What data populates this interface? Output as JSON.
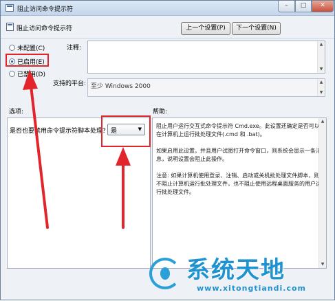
{
  "window": {
    "title": "阻止访问命令提示符",
    "minimize": "–",
    "maximize": "□",
    "close": "✕"
  },
  "header": {
    "title": "阻止访问命令提示符",
    "prev_button": "上一个设置(P)",
    "next_button": "下一个设置(N)"
  },
  "state": {
    "options": [
      {
        "label": "未配置(C)",
        "checked": false
      },
      {
        "label": "已启用(E)",
        "checked": true
      },
      {
        "label": "已禁用(D)",
        "checked": false
      }
    ]
  },
  "comment": {
    "label": "注释:",
    "value": ""
  },
  "supported": {
    "label": "支持的平台:",
    "value": "至少 Windows 2000"
  },
  "options_section": {
    "label": "选项:",
    "question": "是否也要禁用命令提示符脚本处理？",
    "dropdown_value": "是"
  },
  "help_section": {
    "label": "帮助:",
    "paragraphs": [
      "阻止用户运行交互式命令提示符 Cmd.exe。此设置还确定是否可以在计算机上运行批处理文件(.cmd 和 .bat)。",
      "如果启用此设置，并且用户试图打开命令窗口，则系统会显示一条消息，说明设置会阻止此操作。",
      "注意: 如果计算机使用登录、注销、启动或关机批处理文件脚本，则不阻止计算机运行批处理文件，也不阻止使用远程桌面服务的用户运行批处理文件。"
    ]
  },
  "watermark": {
    "text": "系统天地",
    "url": "www.xitongtiandi.com"
  },
  "colors": {
    "annotation_red": "#e2252b",
    "watermark_blue": "#1f93d1",
    "window_bg": "#eef2f7"
  }
}
